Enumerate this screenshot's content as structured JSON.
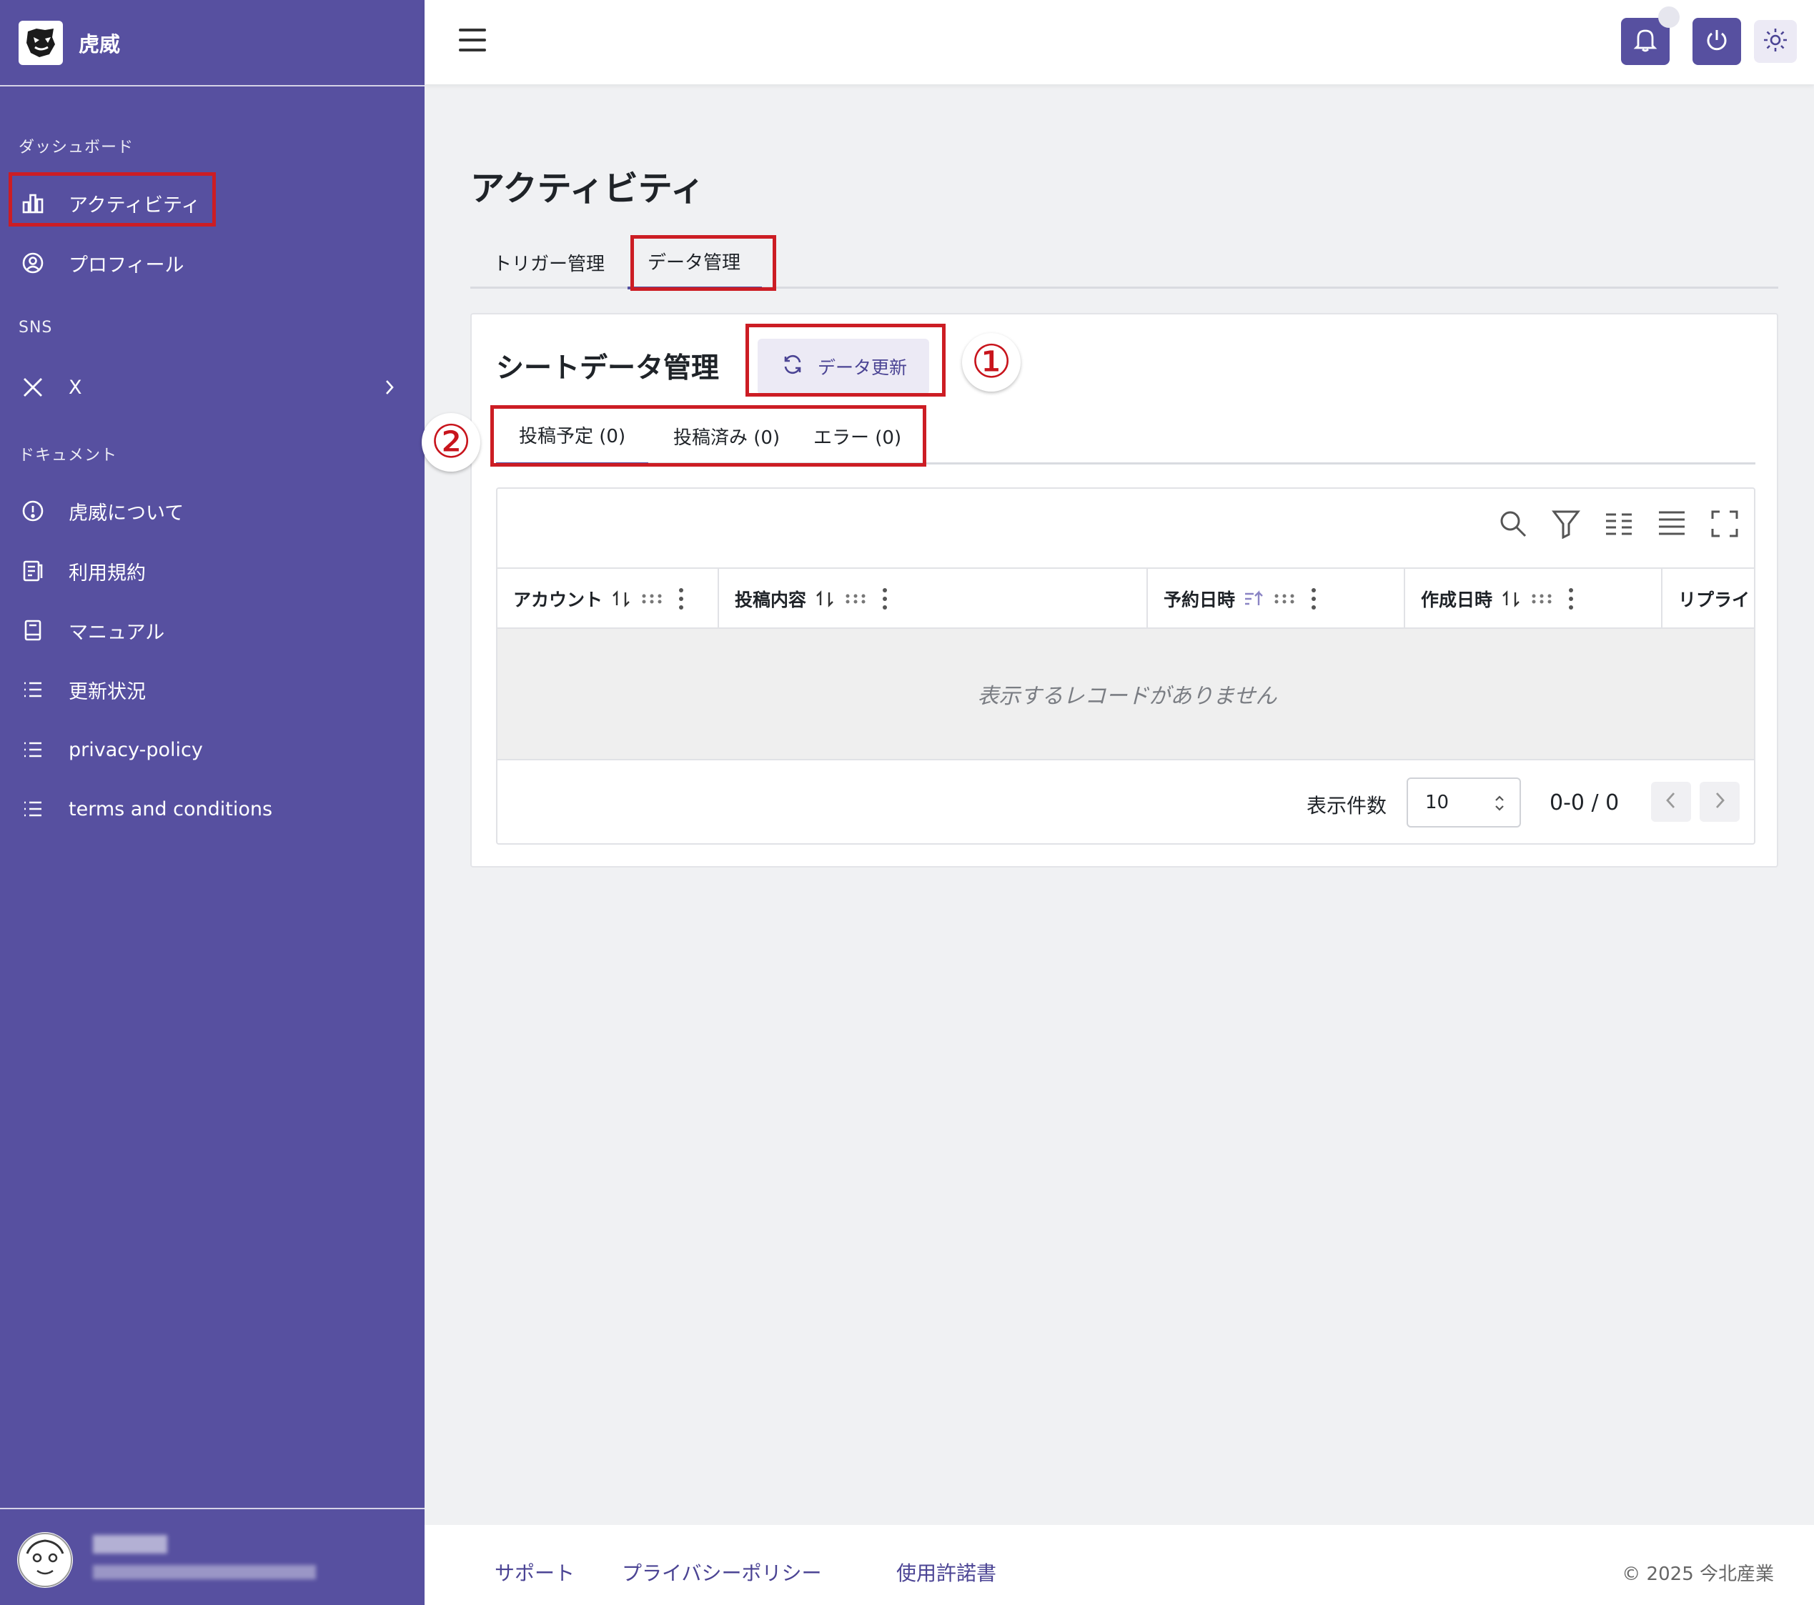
{
  "sidebar": {
    "brand": "虎威",
    "sections": {
      "dashboard": "ダッシュボード",
      "sns": "SNS",
      "docs": "ドキュメント"
    },
    "items": {
      "activity": "アクティビティ",
      "profile": "プロフィール",
      "x": "X",
      "about": "虎威について",
      "terms": "利用規約",
      "manual": "マニュアル",
      "updates": "更新状況",
      "privacy": "privacy-policy",
      "conditions": "terms and conditions"
    }
  },
  "main": {
    "page_title": "アクティビティ",
    "tabs": [
      "トリガー管理",
      "データ管理"
    ],
    "card_title": "シートデータ管理",
    "refresh_label": "データ更新",
    "subtabs": [
      "投稿予定 (0)",
      "投稿済み (0)",
      "エラー (0)"
    ],
    "columns": [
      "アカウント",
      "投稿内容",
      "予約日時",
      "作成日時",
      "リプライ"
    ],
    "empty_message": "表示するレコードがありません",
    "pager": {
      "per_page_label": "表示件数",
      "per_page_value": "10",
      "range": "0-0 / 0"
    }
  },
  "annotations": [
    "①",
    "②"
  ],
  "footer": {
    "links": [
      "サポート",
      "プライバシーポリシー",
      "使用許諾書"
    ],
    "copyright": "© 2025 今北産業"
  },
  "colors": {
    "sidebar_bg": "#5750a0",
    "accent": "#5750a0",
    "annotation_red": "#cc1d24"
  }
}
